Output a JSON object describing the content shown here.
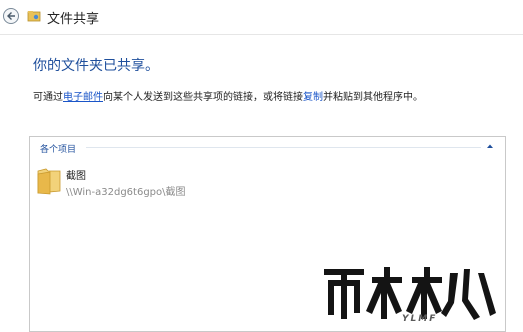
{
  "window": {
    "title": "文件共享",
    "back_icon": "back-arrow-icon",
    "app_icon": "share-folder-icon"
  },
  "main": {
    "heading": "你的文件夹已共享。",
    "desc_prefix": "可通过",
    "email_link": "电子邮件",
    "desc_middle": "向某个人发送到这些共享项的链接，或将链接",
    "copy_link": "复制",
    "desc_suffix": "并粘贴到其他程序中。"
  },
  "items": {
    "group_label": "各个项目",
    "collapse_icon": "chevron-up-icon",
    "list": [
      {
        "name": "截图",
        "path": "\\\\Win-a32dg6t6gpo\\截图",
        "icon": "folder-icon"
      }
    ]
  },
  "watermark": {
    "sub": "YLMF"
  },
  "colors": {
    "accent": "#1f4f9c",
    "link": "#1a55c8",
    "folder": "#e8c15a"
  }
}
